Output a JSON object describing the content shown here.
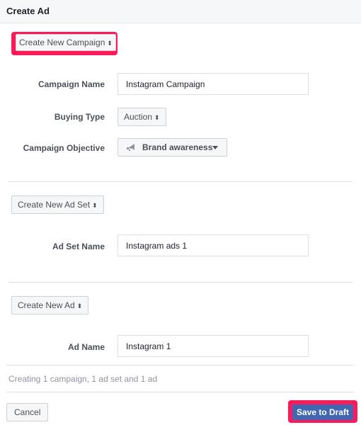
{
  "header": {
    "title": "Create Ad"
  },
  "campaign": {
    "create_button": "Create New Campaign",
    "fields": {
      "name_label": "Campaign Name",
      "name_value": "Instagram Campaign",
      "buying_type_label": "Buying Type",
      "buying_type_value": "Auction",
      "objective_label": "Campaign Objective",
      "objective_value": "Brand awareness",
      "objective_icon": "megaphone-icon"
    }
  },
  "ad_set": {
    "create_button": "Create New Ad Set",
    "name_label": "Ad Set Name",
    "name_value": "Instagram ads 1"
  },
  "ad": {
    "create_button": "Create New Ad",
    "name_label": "Ad Name",
    "name_value": "Instagram 1"
  },
  "summary": "Creating 1 campaign, 1 ad set and 1 ad",
  "footer": {
    "cancel_label": "Cancel",
    "save_label": "Save to Draft"
  },
  "colors": {
    "highlight": "#fc1a5b",
    "primary": "#4267b2"
  }
}
